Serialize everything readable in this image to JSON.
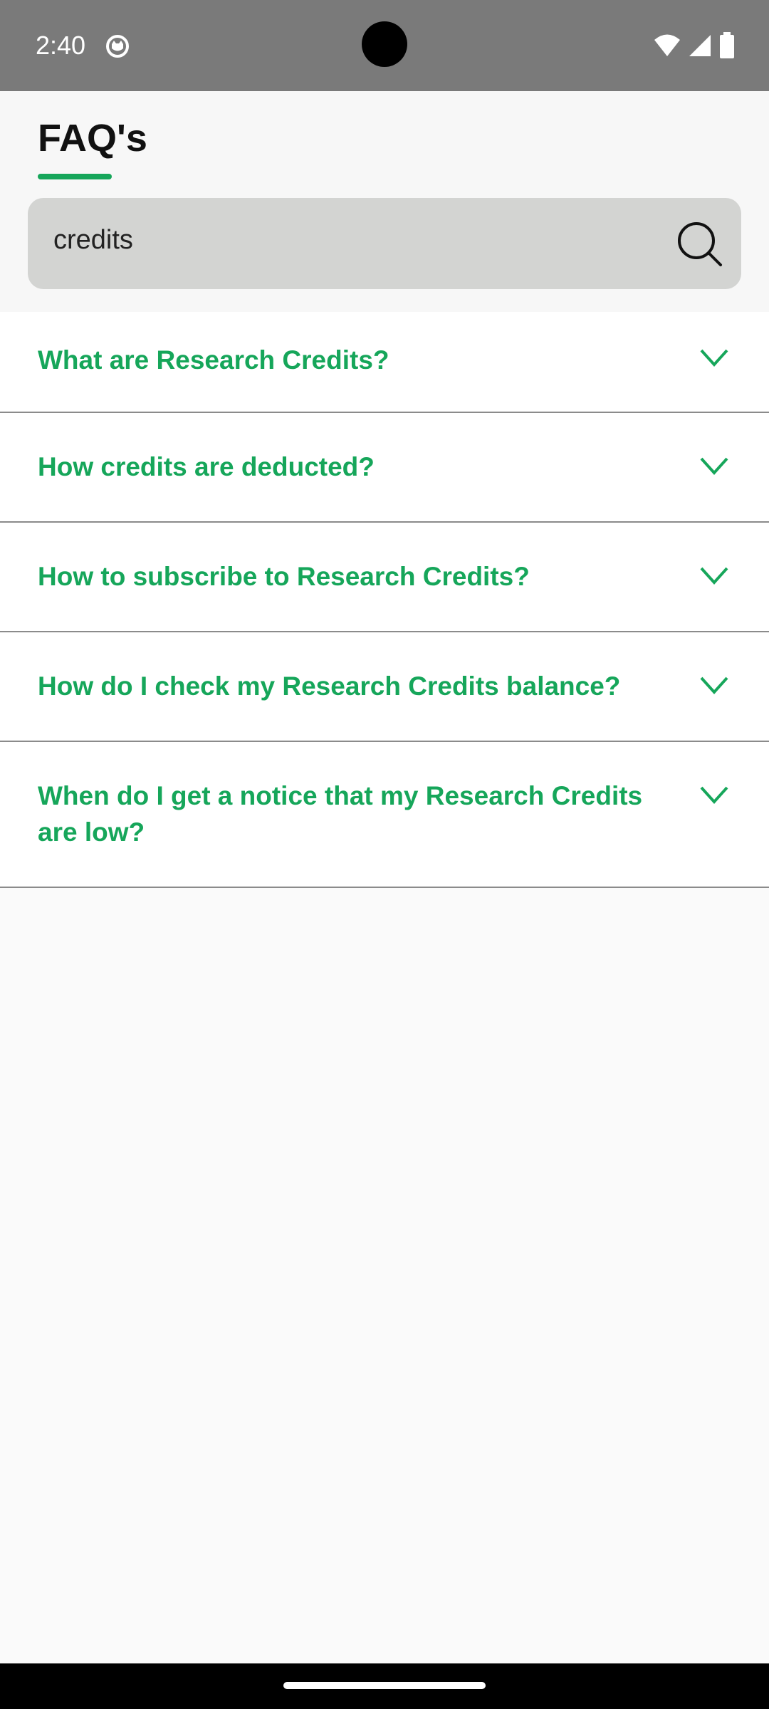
{
  "status_bar": {
    "time": "2:40",
    "icons": [
      "app-notification-icon",
      "wifi-icon",
      "signal-icon",
      "battery-icon"
    ]
  },
  "page": {
    "title": "FAQ's",
    "accent_color": "#16a65a"
  },
  "search": {
    "value": "credits",
    "icon": "search-icon"
  },
  "faqs": [
    {
      "question": "What are Research Credits?"
    },
    {
      "question": "How credits are deducted?"
    },
    {
      "question": "How to subscribe to Research Credits?"
    },
    {
      "question": "How do I check my Research Credits balance?"
    },
    {
      "question": "When do I get a notice that my Research Credits are low?"
    }
  ]
}
